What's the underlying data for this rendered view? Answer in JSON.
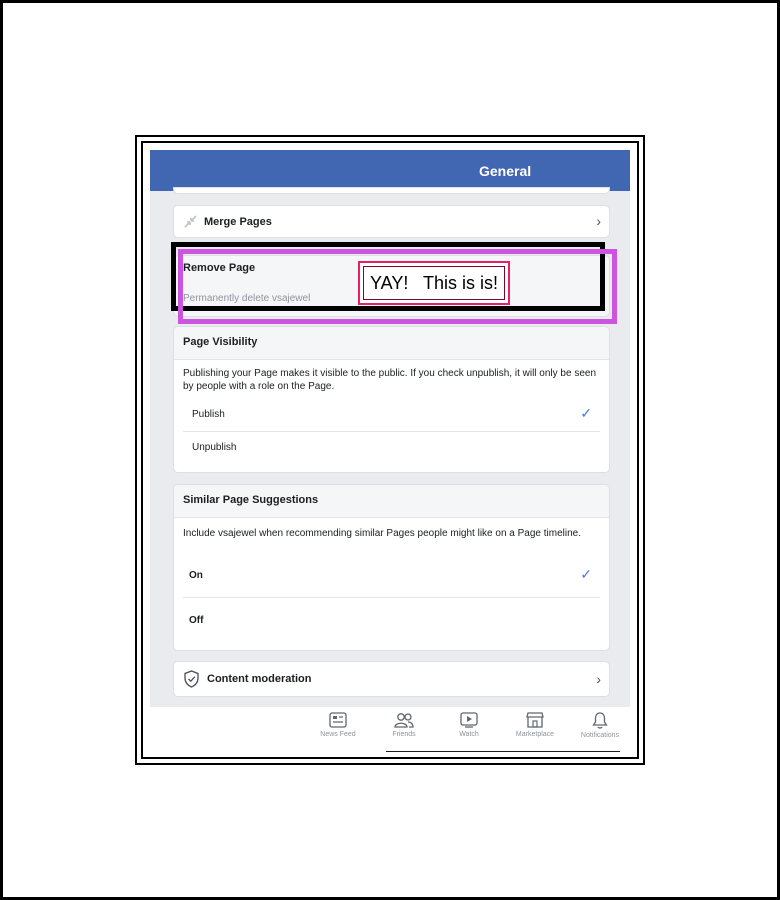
{
  "header": {
    "title": "General"
  },
  "merge_pages": {
    "label": "Merge Pages",
    "icon": "merge-arrows-icon"
  },
  "remove_page": {
    "title": "Remove Page",
    "description": "Permanently delete vsajewel"
  },
  "page_visibility": {
    "title": "Page Visibility",
    "description": "Publishing your Page makes it visible to the public. If you check unpublish, it will only be seen by people with a role on the Page.",
    "options": [
      {
        "label": "Publish",
        "selected": true
      },
      {
        "label": "Unpublish",
        "selected": false
      }
    ]
  },
  "similar_pages": {
    "title": "Similar Page Suggestions",
    "description": "Include vsajewel when recommending similar Pages people might like on a Page timeline.",
    "options": [
      {
        "label": "On",
        "selected": true
      },
      {
        "label": "Off",
        "selected": false
      }
    ]
  },
  "content_moderation": {
    "label": "Content moderation",
    "icon": "shield-check-icon"
  },
  "bottom_nav": [
    {
      "label": "News Feed",
      "icon": "news-feed-icon"
    },
    {
      "label": "Friends",
      "icon": "friends-icon"
    },
    {
      "label": "Watch",
      "icon": "watch-icon"
    },
    {
      "label": "Marketplace",
      "icon": "marketplace-icon"
    },
    {
      "label": "Notifications",
      "icon": "bell-icon"
    }
  ],
  "annotation": {
    "text": "YAY!   This is is!"
  },
  "colors": {
    "header_blue": "#4267b2",
    "check_blue": "#4a7ae0",
    "annotation_purple": "#cc55e0",
    "annotation_pink": "#e91e63"
  }
}
